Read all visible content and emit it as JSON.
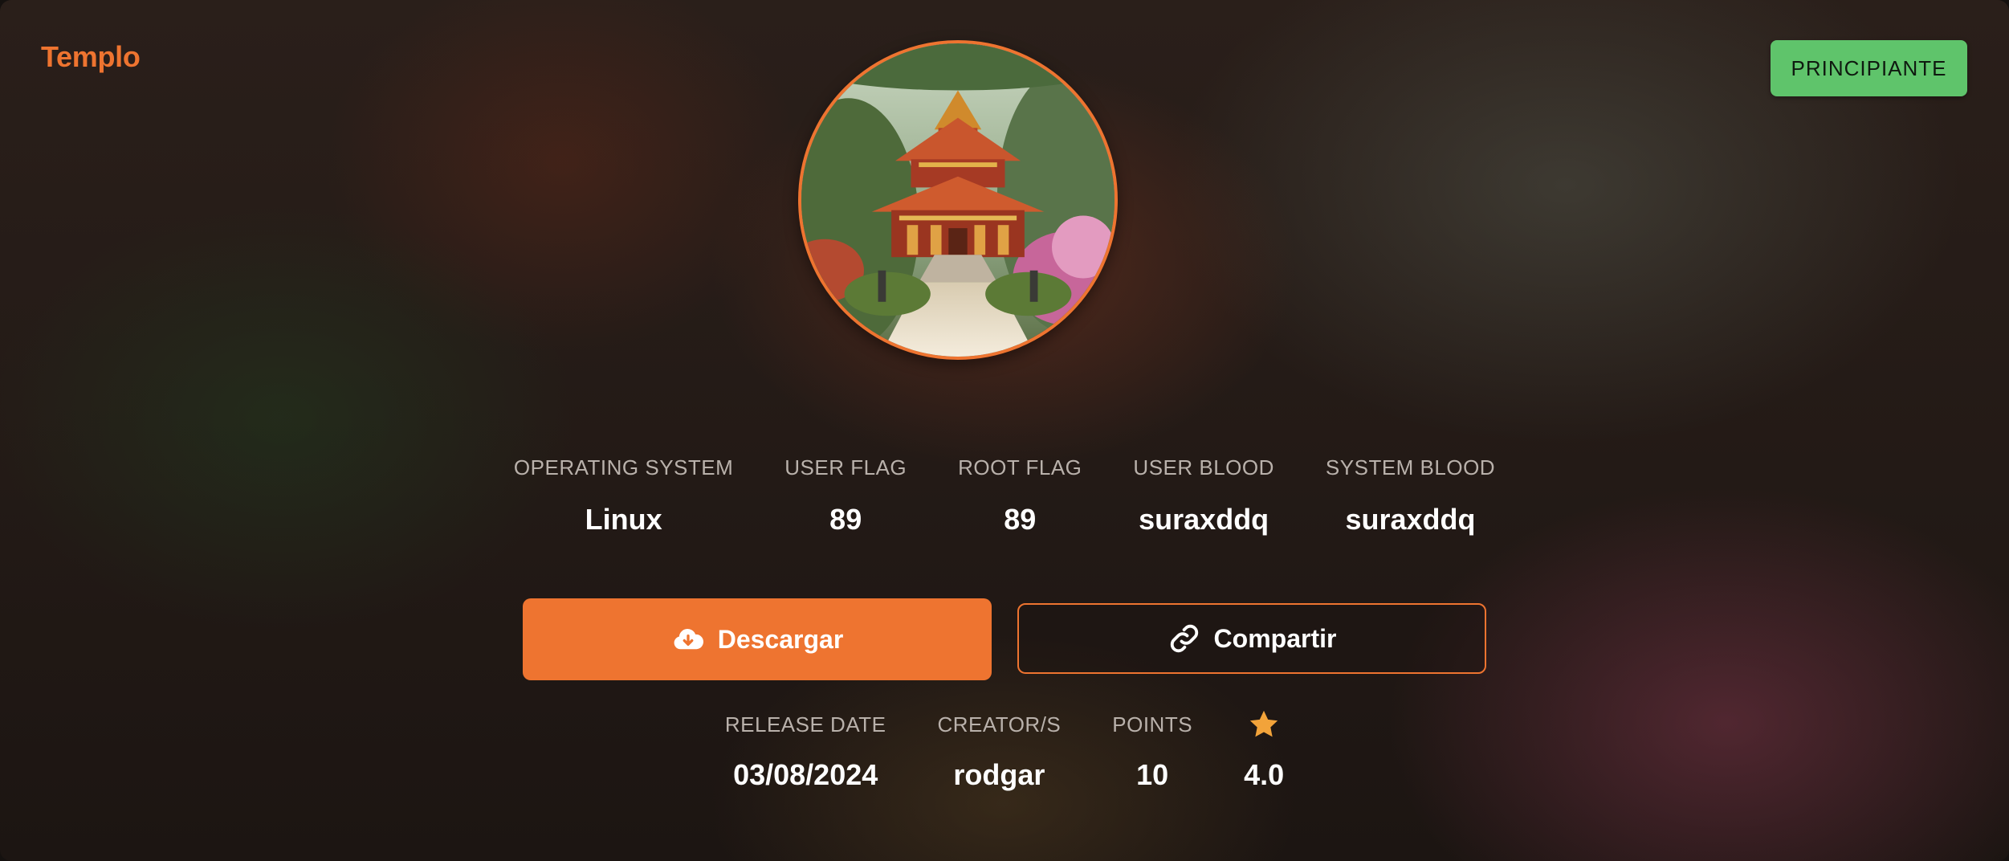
{
  "machine": {
    "name": "Templo",
    "difficulty": "PRINCIPIANTE",
    "colors": {
      "accent": "#ee7430",
      "difficulty": "#5fc46b"
    }
  },
  "stats_top": [
    {
      "label": "OPERATING SYSTEM",
      "value": "Linux"
    },
    {
      "label": "USER FLAG",
      "value": "89"
    },
    {
      "label": "ROOT FLAG",
      "value": "89"
    },
    {
      "label": "USER BLOOD",
      "value": "suraxddq"
    },
    {
      "label": "SYSTEM BLOOD",
      "value": "suraxddq"
    }
  ],
  "actions": {
    "download": {
      "label": "Descargar",
      "icon": "cloud-download-icon"
    },
    "share": {
      "label": "Compartir",
      "icon": "link-icon"
    }
  },
  "stats_bottom": [
    {
      "label": "RELEASE DATE",
      "value": "03/08/2024"
    },
    {
      "label": "CREATOR/S",
      "value": "rodgar"
    },
    {
      "label": "POINTS",
      "value": "10"
    },
    {
      "icon": "star-icon",
      "value": "4.0"
    }
  ]
}
